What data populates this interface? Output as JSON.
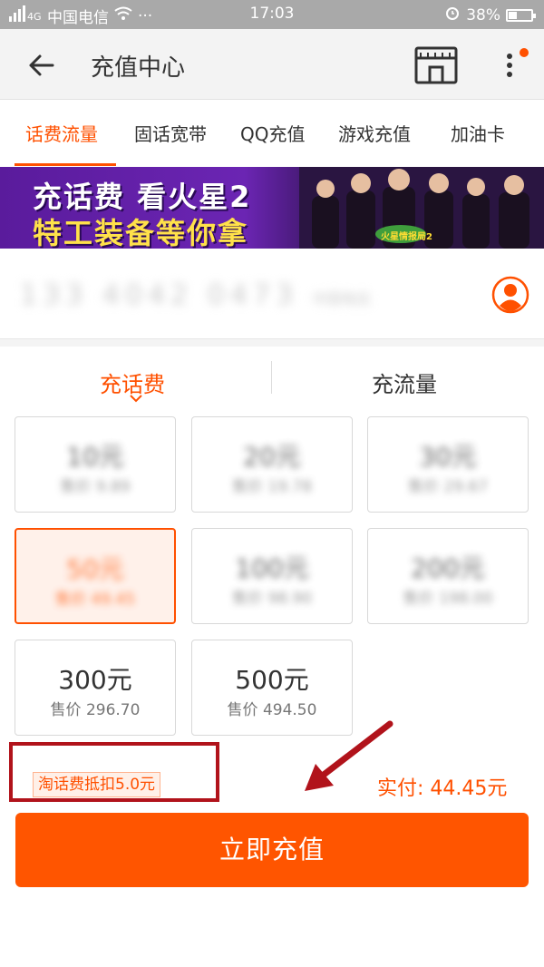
{
  "status_bar": {
    "carrier": "中国电信",
    "signal_label": "4G",
    "time": "17:03",
    "battery": "38%"
  },
  "header": {
    "title": "充值中心"
  },
  "tabs": [
    {
      "label": "话费流量",
      "active": true
    },
    {
      "label": "固话宽带",
      "active": false
    },
    {
      "label": "QQ充值",
      "active": false
    },
    {
      "label": "游戏充值",
      "active": false
    },
    {
      "label": "加油卡",
      "active": false
    }
  ],
  "banner": {
    "line1": "充话费 看火星2",
    "line2": "特工装备等你拿",
    "badge": "火星情报局2"
  },
  "phone": {
    "number": "133 4042 0473",
    "hint": "中国电信"
  },
  "recharge_tabs": [
    {
      "label": "充话费",
      "active": true
    },
    {
      "label": "充流量",
      "active": false
    }
  ],
  "denominations": [
    {
      "amount": "10元",
      "price": "售价 9.89",
      "selected": false,
      "blurred": true
    },
    {
      "amount": "20元",
      "price": "售价 19.78",
      "selected": false,
      "blurred": true
    },
    {
      "amount": "30元",
      "price": "售价 29.67",
      "selected": false,
      "blurred": true
    },
    {
      "amount": "50元",
      "price": "售价 49.45",
      "selected": true,
      "blurred": true
    },
    {
      "amount": "100元",
      "price": "售价 98.90",
      "selected": false,
      "blurred": true
    },
    {
      "amount": "200元",
      "price": "售价 198.00",
      "selected": false,
      "blurred": true
    },
    {
      "amount": "300元",
      "price": "售价 296.70",
      "selected": false,
      "blurred": false
    },
    {
      "amount": "500元",
      "price": "售价 494.50",
      "selected": false,
      "blurred": false
    }
  ],
  "footer": {
    "deduct": "淘话费抵扣5.0元",
    "pay": "实付: 44.45元",
    "cta": "立即充值"
  },
  "colors": {
    "accent": "#ff5000",
    "cta": "#ff5500",
    "highlight_box": "#b1131b"
  }
}
